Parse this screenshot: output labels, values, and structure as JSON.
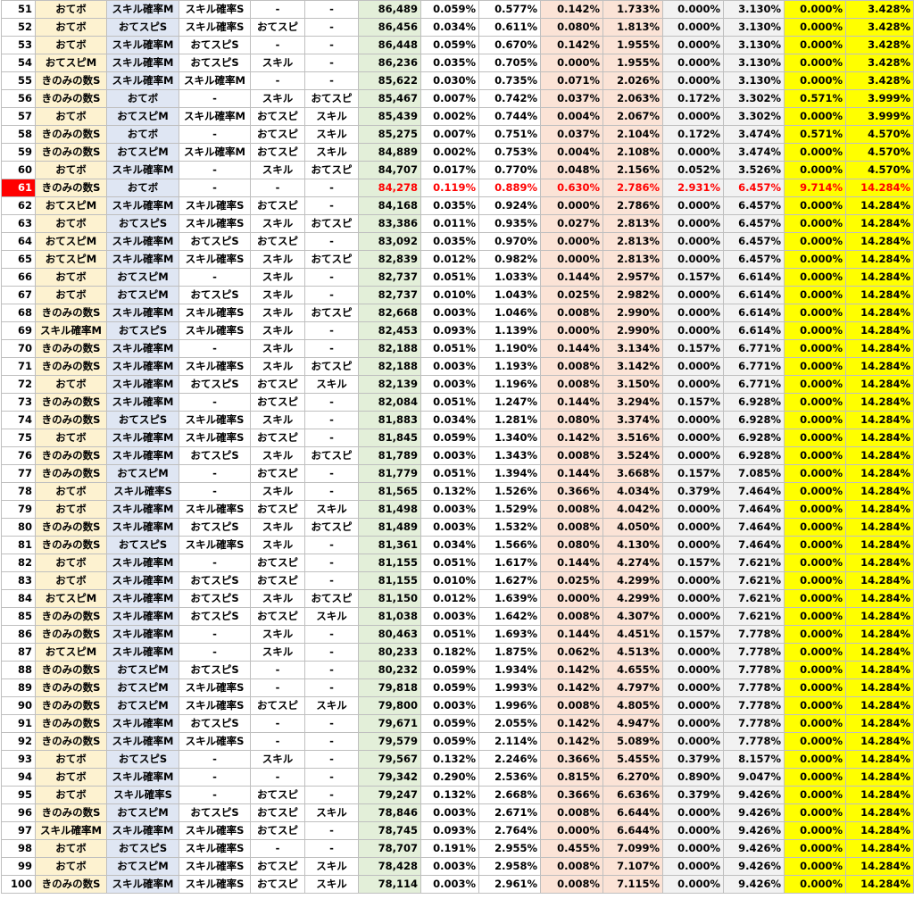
{
  "colors": {
    "highlight_row_bg": "#ff0000",
    "red_text": "#ff0000",
    "blue_text": "#0070c0",
    "yellow": "#ffff00",
    "green": "#e3efd9",
    "peach": "#fbe3d6",
    "grey": "#f2f2f2",
    "cream": "#fdf2d0",
    "lavender": "#dfe6f3"
  },
  "highlight_row": "61",
  "rows": [
    [
      "51",
      "おてボ",
      "スキル確率M",
      "スキル確率S",
      "-",
      "-",
      "86,489",
      "0.059%",
      "0.577%",
      "0.142%",
      "1.733%",
      "0.000%",
      "3.130%",
      "0.000%",
      "3.428%"
    ],
    [
      "52",
      "おてボ",
      "おてスピS",
      "スキル確率S",
      "おてスピ",
      "-",
      "86,456",
      "0.034%",
      "0.611%",
      "0.080%",
      "1.813%",
      "0.000%",
      "3.130%",
      "0.000%",
      "3.428%"
    ],
    [
      "53",
      "おてボ",
      "スキル確率M",
      "おてスピS",
      "-",
      "-",
      "86,448",
      "0.059%",
      "0.670%",
      "0.142%",
      "1.955%",
      "0.000%",
      "3.130%",
      "0.000%",
      "3.428%"
    ],
    [
      "54",
      "おてスピM",
      "スキル確率M",
      "おてスピS",
      "スキル",
      "-",
      "86,236",
      "0.035%",
      "0.705%",
      "0.000%",
      "1.955%",
      "0.000%",
      "3.130%",
      "0.000%",
      "3.428%"
    ],
    [
      "55",
      "きのみの数S",
      "スキル確率M",
      "スキル確率M",
      "-",
      "-",
      "85,622",
      "0.030%",
      "0.735%",
      "0.071%",
      "2.026%",
      "0.000%",
      "3.130%",
      "0.000%",
      "3.428%"
    ],
    [
      "56",
      "きのみの数S",
      "おてボ",
      "-",
      "スキル",
      "おてスピ",
      "85,467",
      "0.007%",
      "0.742%",
      "0.037%",
      "2.063%",
      "0.172%",
      "3.302%",
      "0.571%",
      "3.999%"
    ],
    [
      "57",
      "おてボ",
      "おてスピM",
      "スキル確率M",
      "おてスピ",
      "スキル",
      "85,439",
      "0.002%",
      "0.744%",
      "0.004%",
      "2.067%",
      "0.000%",
      "3.302%",
      "0.000%",
      "3.999%"
    ],
    [
      "58",
      "きのみの数S",
      "おてボ",
      "-",
      "おてスピ",
      "スキル",
      "85,275",
      "0.007%",
      "0.751%",
      "0.037%",
      "2.104%",
      "0.172%",
      "3.474%",
      "0.571%",
      "4.570%"
    ],
    [
      "59",
      "きのみの数S",
      "おてスピM",
      "スキル確率M",
      "おてスピ",
      "スキル",
      "84,889",
      "0.002%",
      "0.753%",
      "0.004%",
      "2.108%",
      "0.000%",
      "3.474%",
      "0.000%",
      "4.570%"
    ],
    [
      "60",
      "おてボ",
      "スキル確率M",
      "-",
      "スキル",
      "おてスピ",
      "84,707",
      "0.017%",
      "0.770%",
      "0.048%",
      "2.156%",
      "0.052%",
      "3.526%",
      "0.000%",
      "4.570%"
    ],
    [
      "61",
      "きのみの数S",
      "おてボ",
      "-",
      "-",
      "-",
      "84,278",
      "0.119%",
      "0.889%",
      "0.630%",
      "2.786%",
      "2.931%",
      "6.457%",
      "9.714%",
      "14.284%"
    ],
    [
      "62",
      "おてスピM",
      "スキル確率M",
      "スキル確率S",
      "おてスピ",
      "-",
      "84,168",
      "0.035%",
      "0.924%",
      "0.000%",
      "2.786%",
      "0.000%",
      "6.457%",
      "0.000%",
      "14.284%"
    ],
    [
      "63",
      "おてボ",
      "おてスピS",
      "スキル確率S",
      "スキル",
      "おてスピ",
      "83,386",
      "0.011%",
      "0.935%",
      "0.027%",
      "2.813%",
      "0.000%",
      "6.457%",
      "0.000%",
      "14.284%"
    ],
    [
      "64",
      "おてスピM",
      "スキル確率M",
      "おてスピS",
      "おてスピ",
      "-",
      "83,092",
      "0.035%",
      "0.970%",
      "0.000%",
      "2.813%",
      "0.000%",
      "6.457%",
      "0.000%",
      "14.284%"
    ],
    [
      "65",
      "おてスピM",
      "スキル確率M",
      "スキル確率S",
      "スキル",
      "おてスピ",
      "82,839",
      "0.012%",
      "0.982%",
      "0.000%",
      "2.813%",
      "0.000%",
      "6.457%",
      "0.000%",
      "14.284%"
    ],
    [
      "66",
      "おてボ",
      "おてスピM",
      "-",
      "スキル",
      "-",
      "82,737",
      "0.051%",
      "1.033%",
      "0.144%",
      "2.957%",
      "0.157%",
      "6.614%",
      "0.000%",
      "14.284%"
    ],
    [
      "67",
      "おてボ",
      "おてスピM",
      "おてスピS",
      "スキル",
      "-",
      "82,737",
      "0.010%",
      "1.043%",
      "0.025%",
      "2.982%",
      "0.000%",
      "6.614%",
      "0.000%",
      "14.284%"
    ],
    [
      "68",
      "きのみの数S",
      "スキル確率M",
      "スキル確率S",
      "スキル",
      "おてスピ",
      "82,668",
      "0.003%",
      "1.046%",
      "0.008%",
      "2.990%",
      "0.000%",
      "6.614%",
      "0.000%",
      "14.284%"
    ],
    [
      "69",
      "スキル確率M",
      "おてスピS",
      "スキル確率S",
      "スキル",
      "-",
      "82,453",
      "0.093%",
      "1.139%",
      "0.000%",
      "2.990%",
      "0.000%",
      "6.614%",
      "0.000%",
      "14.284%"
    ],
    [
      "70",
      "きのみの数S",
      "スキル確率M",
      "-",
      "スキル",
      "-",
      "82,188",
      "0.051%",
      "1.190%",
      "0.144%",
      "3.134%",
      "0.157%",
      "6.771%",
      "0.000%",
      "14.284%"
    ],
    [
      "71",
      "きのみの数S",
      "スキル確率M",
      "スキル確率S",
      "スキル",
      "おてスピ",
      "82,188",
      "0.003%",
      "1.193%",
      "0.008%",
      "3.142%",
      "0.000%",
      "6.771%",
      "0.000%",
      "14.284%"
    ],
    [
      "72",
      "おてボ",
      "スキル確率M",
      "おてスピS",
      "おてスピ",
      "スキル",
      "82,139",
      "0.003%",
      "1.196%",
      "0.008%",
      "3.150%",
      "0.000%",
      "6.771%",
      "0.000%",
      "14.284%"
    ],
    [
      "73",
      "きのみの数S",
      "スキル確率M",
      "-",
      "おてスピ",
      "-",
      "82,084",
      "0.051%",
      "1.247%",
      "0.144%",
      "3.294%",
      "0.157%",
      "6.928%",
      "0.000%",
      "14.284%"
    ],
    [
      "74",
      "きのみの数S",
      "おてスピS",
      "スキル確率S",
      "スキル",
      "-",
      "81,883",
      "0.034%",
      "1.281%",
      "0.080%",
      "3.374%",
      "0.000%",
      "6.928%",
      "0.000%",
      "14.284%"
    ],
    [
      "75",
      "おてボ",
      "スキル確率M",
      "スキル確率S",
      "おてスピ",
      "-",
      "81,845",
      "0.059%",
      "1.340%",
      "0.142%",
      "3.516%",
      "0.000%",
      "6.928%",
      "0.000%",
      "14.284%"
    ],
    [
      "76",
      "きのみの数S",
      "スキル確率M",
      "おてスピS",
      "スキル",
      "おてスピ",
      "81,789",
      "0.003%",
      "1.343%",
      "0.008%",
      "3.524%",
      "0.000%",
      "6.928%",
      "0.000%",
      "14.284%"
    ],
    [
      "77",
      "きのみの数S",
      "おてスピM",
      "-",
      "おてスピ",
      "-",
      "81,779",
      "0.051%",
      "1.394%",
      "0.144%",
      "3.668%",
      "0.157%",
      "7.085%",
      "0.000%",
      "14.284%"
    ],
    [
      "78",
      "おてボ",
      "スキル確率S",
      "-",
      "スキル",
      "-",
      "81,565",
      "0.132%",
      "1.526%",
      "0.366%",
      "4.034%",
      "0.379%",
      "7.464%",
      "0.000%",
      "14.284%"
    ],
    [
      "79",
      "おてボ",
      "スキル確率M",
      "スキル確率S",
      "おてスピ",
      "スキル",
      "81,498",
      "0.003%",
      "1.529%",
      "0.008%",
      "4.042%",
      "0.000%",
      "7.464%",
      "0.000%",
      "14.284%"
    ],
    [
      "80",
      "きのみの数S",
      "スキル確率M",
      "おてスピS",
      "スキル",
      "おてスピ",
      "81,489",
      "0.003%",
      "1.532%",
      "0.008%",
      "4.050%",
      "0.000%",
      "7.464%",
      "0.000%",
      "14.284%"
    ],
    [
      "81",
      "きのみの数S",
      "おてスピS",
      "スキル確率S",
      "スキル",
      "-",
      "81,361",
      "0.034%",
      "1.566%",
      "0.080%",
      "4.130%",
      "0.000%",
      "7.464%",
      "0.000%",
      "14.284%"
    ],
    [
      "82",
      "おてボ",
      "スキル確率M",
      "-",
      "おてスピ",
      "-",
      "81,155",
      "0.051%",
      "1.617%",
      "0.144%",
      "4.274%",
      "0.157%",
      "7.621%",
      "0.000%",
      "14.284%"
    ],
    [
      "83",
      "おてボ",
      "スキル確率M",
      "おてスピS",
      "おてスピ",
      "-",
      "81,155",
      "0.010%",
      "1.627%",
      "0.025%",
      "4.299%",
      "0.000%",
      "7.621%",
      "0.000%",
      "14.284%"
    ],
    [
      "84",
      "おてスピM",
      "スキル確率M",
      "おてスピS",
      "スキル",
      "おてスピ",
      "81,150",
      "0.012%",
      "1.639%",
      "0.000%",
      "4.299%",
      "0.000%",
      "7.621%",
      "0.000%",
      "14.284%"
    ],
    [
      "85",
      "きのみの数S",
      "スキル確率M",
      "おてスピS",
      "おてスピ",
      "スキル",
      "81,038",
      "0.003%",
      "1.642%",
      "0.008%",
      "4.307%",
      "0.000%",
      "7.621%",
      "0.000%",
      "14.284%"
    ],
    [
      "86",
      "きのみの数S",
      "スキル確率M",
      "-",
      "スキル",
      "-",
      "80,463",
      "0.051%",
      "1.693%",
      "0.144%",
      "4.451%",
      "0.157%",
      "7.778%",
      "0.000%",
      "14.284%"
    ],
    [
      "87",
      "おてスピM",
      "スキル確率M",
      "-",
      "スキル",
      "-",
      "80,233",
      "0.182%",
      "1.875%",
      "0.062%",
      "4.513%",
      "0.000%",
      "7.778%",
      "0.000%",
      "14.284%"
    ],
    [
      "88",
      "きのみの数S",
      "おてスピM",
      "おてスピS",
      "-",
      "-",
      "80,232",
      "0.059%",
      "1.934%",
      "0.142%",
      "4.655%",
      "0.000%",
      "7.778%",
      "0.000%",
      "14.284%"
    ],
    [
      "89",
      "きのみの数S",
      "おてスピM",
      "スキル確率S",
      "-",
      "-",
      "79,818",
      "0.059%",
      "1.993%",
      "0.142%",
      "4.797%",
      "0.000%",
      "7.778%",
      "0.000%",
      "14.284%"
    ],
    [
      "90",
      "きのみの数S",
      "おてスピM",
      "スキル確率S",
      "おてスピ",
      "スキル",
      "79,800",
      "0.003%",
      "1.996%",
      "0.008%",
      "4.805%",
      "0.000%",
      "7.778%",
      "0.000%",
      "14.284%"
    ],
    [
      "91",
      "きのみの数S",
      "スキル確率M",
      "おてスピS",
      "-",
      "-",
      "79,671",
      "0.059%",
      "2.055%",
      "0.142%",
      "4.947%",
      "0.000%",
      "7.778%",
      "0.000%",
      "14.284%"
    ],
    [
      "92",
      "きのみの数S",
      "スキル確率M",
      "スキル確率S",
      "-",
      "-",
      "79,579",
      "0.059%",
      "2.114%",
      "0.142%",
      "5.089%",
      "0.000%",
      "7.778%",
      "0.000%",
      "14.284%"
    ],
    [
      "93",
      "おてボ",
      "おてスピS",
      "-",
      "スキル",
      "-",
      "79,567",
      "0.132%",
      "2.246%",
      "0.366%",
      "5.455%",
      "0.379%",
      "8.157%",
      "0.000%",
      "14.284%"
    ],
    [
      "94",
      "おてボ",
      "スキル確率M",
      "-",
      "-",
      "-",
      "79,342",
      "0.290%",
      "2.536%",
      "0.815%",
      "6.270%",
      "0.890%",
      "9.047%",
      "0.000%",
      "14.284%"
    ],
    [
      "95",
      "おてボ",
      "スキル確率S",
      "-",
      "おてスピ",
      "-",
      "79,247",
      "0.132%",
      "2.668%",
      "0.366%",
      "6.636%",
      "0.379%",
      "9.426%",
      "0.000%",
      "14.284%"
    ],
    [
      "96",
      "きのみの数S",
      "おてスピM",
      "おてスピS",
      "おてスピ",
      "スキル",
      "78,846",
      "0.003%",
      "2.671%",
      "0.008%",
      "6.644%",
      "0.000%",
      "9.426%",
      "0.000%",
      "14.284%"
    ],
    [
      "97",
      "スキル確率M",
      "スキル確率M",
      "スキル確率S",
      "おてスピ",
      "-",
      "78,745",
      "0.093%",
      "2.764%",
      "0.000%",
      "6.644%",
      "0.000%",
      "9.426%",
      "0.000%",
      "14.284%"
    ],
    [
      "98",
      "おてボ",
      "おてスピS",
      "スキル確率S",
      "-",
      "-",
      "78,707",
      "0.191%",
      "2.955%",
      "0.455%",
      "7.099%",
      "0.000%",
      "9.426%",
      "0.000%",
      "14.284%"
    ],
    [
      "99",
      "おてボ",
      "おてスピM",
      "スキル確率S",
      "おてスピ",
      "スキル",
      "78,428",
      "0.003%",
      "2.958%",
      "0.008%",
      "7.107%",
      "0.000%",
      "9.426%",
      "0.000%",
      "14.284%"
    ],
    [
      "100",
      "きのみの数S",
      "スキル確率M",
      "スキル確率S",
      "おてスピ",
      "スキル",
      "78,114",
      "0.003%",
      "2.961%",
      "0.008%",
      "7.115%",
      "0.000%",
      "9.426%",
      "0.000%",
      "14.284%"
    ]
  ]
}
